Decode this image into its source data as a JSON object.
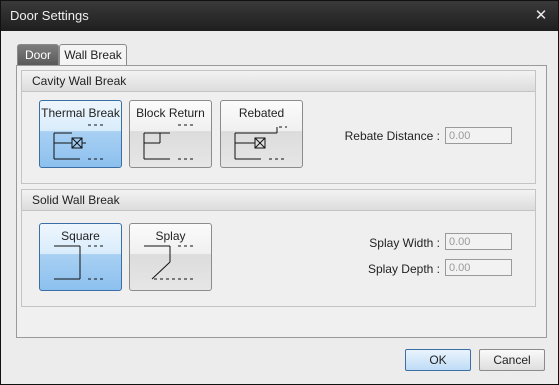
{
  "window": {
    "title": "Door Settings",
    "close_glyph": "✕"
  },
  "tabs": [
    {
      "label": "Door"
    },
    {
      "label": "Wall Break"
    }
  ],
  "cavity_group": {
    "title": "Cavity Wall Break",
    "options": [
      {
        "label": "Thermal Break",
        "selected": true
      },
      {
        "label": "Block Return",
        "selected": false
      },
      {
        "label": "Rebated",
        "selected": false
      }
    ],
    "rebate_distance": {
      "label": "Rebate Distance :",
      "value": "0.00"
    }
  },
  "solid_group": {
    "title": "Solid Wall Break",
    "options": [
      {
        "label": "Square",
        "selected": true
      },
      {
        "label": "Splay",
        "selected": false
      }
    ],
    "splay_width": {
      "label": "Splay Width :",
      "value": "0.00"
    },
    "splay_depth": {
      "label": "Splay Depth :",
      "value": "0.00"
    }
  },
  "buttons": {
    "ok": "OK",
    "cancel": "Cancel"
  },
  "colors": {
    "selected_blue": "#8cc0ee",
    "titlebar": "#2a2a2a"
  }
}
